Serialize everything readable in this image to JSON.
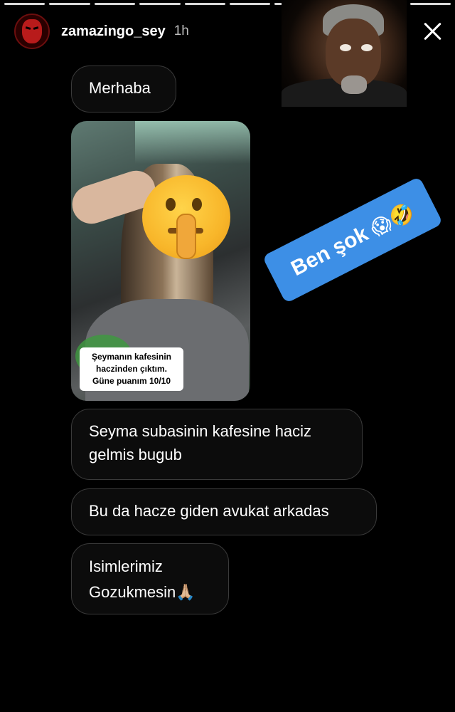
{
  "story": {
    "username": "zamazingo_sey",
    "time": "1h",
    "progress_segments": 10
  },
  "icons": {
    "avatar": "devil-avatar",
    "close": "close-icon"
  },
  "sticker": {
    "ben_sok_text": "Ben şok",
    "ben_sok_emoji": "😱🤣"
  },
  "messages": [
    {
      "text": "Merhaba"
    },
    {
      "text": "Seyma subasinin kafesine haciz gelmis bugub"
    },
    {
      "text": "Bu da hacze giden avukat arkadas"
    },
    {
      "text": "Isimlerimiz Gozukmesin🙏🏼"
    }
  ],
  "shared_photo": {
    "caption": "Şeymanın kafesinin haczinden çıktım. Güne puanım 10/10"
  },
  "colors": {
    "background": "#000000",
    "bubble_border": "#3a3a3a",
    "sticker_blue": "#3d8fe6"
  }
}
